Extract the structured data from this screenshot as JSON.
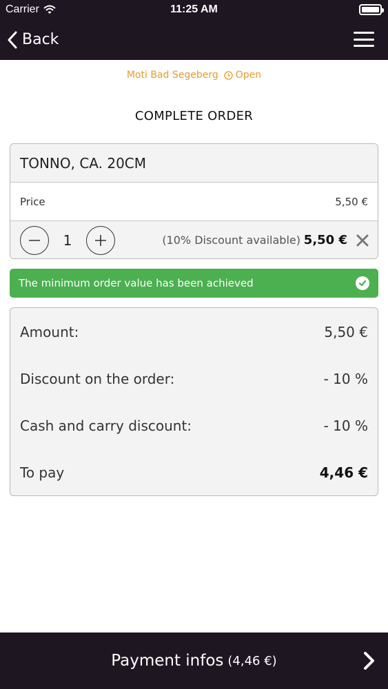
{
  "status_bar": {
    "carrier": "Carrier",
    "time": "11:25 AM"
  },
  "nav": {
    "back_label": "Back"
  },
  "shop": {
    "name": "Moti Bad Segeberg",
    "status": "Open"
  },
  "page_title": "COMPLETE ORDER",
  "item": {
    "name": "TONNO, CA. 20CM",
    "price_label": "Price",
    "price_value": "5,50 €",
    "quantity": "1",
    "discount_note": "(10% Discount available)",
    "line_total": "5,50 €"
  },
  "banner": {
    "text": "The minimum order value has been achieved"
  },
  "summary": {
    "rows": [
      {
        "label": "Amount:",
        "value": "5,50 €"
      },
      {
        "label": "Discount on the order:",
        "value": "- 10 %"
      },
      {
        "label": "Cash and carry discount:",
        "value": "- 10 %"
      },
      {
        "label": "To pay",
        "value": "4,46 €"
      }
    ]
  },
  "footer": {
    "label": "Payment infos",
    "amount": "(4,46 €)"
  },
  "colors": {
    "nav_background": "#1e1620",
    "accent_orange": "#e89a2a",
    "success_green": "#4caf50"
  },
  "icons": [
    "wifi-icon",
    "battery-icon",
    "chevron-left-icon",
    "hamburger-menu-icon",
    "clock-icon",
    "minus-icon",
    "plus-icon",
    "close-icon",
    "check-circle-icon",
    "chevron-right-icon"
  ]
}
